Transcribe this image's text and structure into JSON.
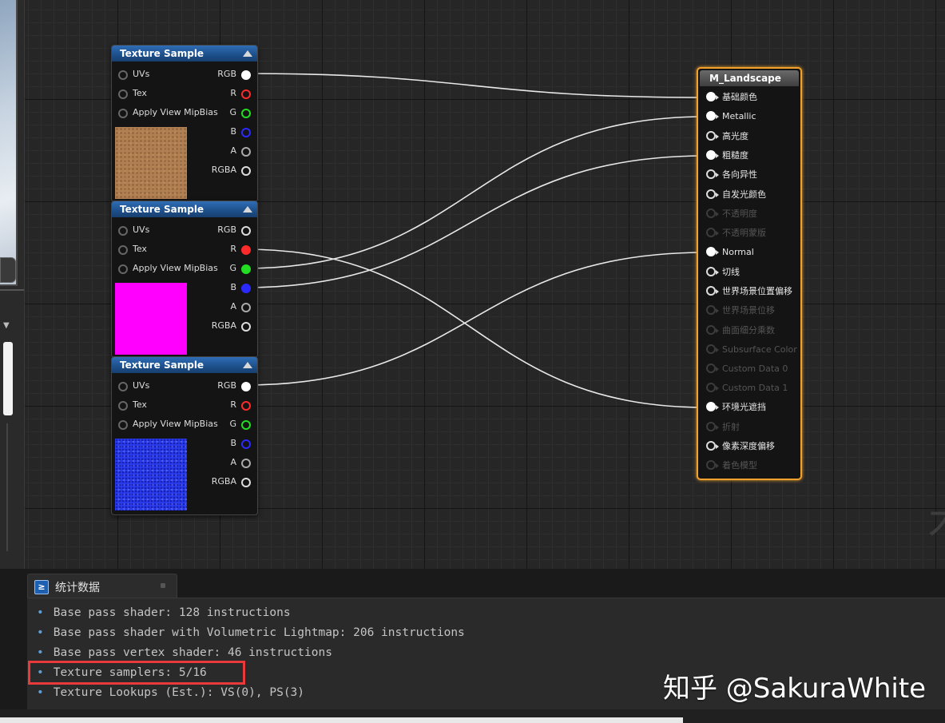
{
  "nodes": [
    {
      "title": "Texture Sample",
      "inputs": [
        "UVs",
        "Tex",
        "Apply View MipBias"
      ],
      "outputs": [
        "RGB",
        "R",
        "G",
        "B",
        "A",
        "RGBA"
      ],
      "thumb_color": "#b07f52"
    },
    {
      "title": "Texture Sample",
      "inputs": [
        "UVs",
        "Tex",
        "Apply View MipBias"
      ],
      "outputs": [
        "RGB",
        "R",
        "G",
        "B",
        "A",
        "RGBA"
      ],
      "thumb_color": "#ff00ff"
    },
    {
      "title": "Texture Sample",
      "inputs": [
        "UVs",
        "Tex",
        "Apply View MipBias"
      ],
      "outputs": [
        "RGB",
        "R",
        "G",
        "B",
        "A",
        "RGBA"
      ],
      "thumb_color": "#2a3bf0"
    }
  ],
  "material": {
    "title": "M_Landscape",
    "pins": [
      {
        "label": "基础颜色",
        "enabled": true,
        "connected": true
      },
      {
        "label": "Metallic",
        "enabled": true,
        "connected": true
      },
      {
        "label": "高光度",
        "enabled": true,
        "connected": false
      },
      {
        "label": "粗糙度",
        "enabled": true,
        "connected": true
      },
      {
        "label": "各向异性",
        "enabled": true,
        "connected": false
      },
      {
        "label": "自发光颜色",
        "enabled": true,
        "connected": false
      },
      {
        "label": "不透明度",
        "enabled": false,
        "connected": false
      },
      {
        "label": "不透明蒙版",
        "enabled": false,
        "connected": false
      },
      {
        "label": "Normal",
        "enabled": true,
        "connected": true
      },
      {
        "label": "切线",
        "enabled": true,
        "connected": false
      },
      {
        "label": "世界场景位置偏移",
        "enabled": true,
        "connected": false
      },
      {
        "label": "世界场景位移",
        "enabled": false,
        "connected": false
      },
      {
        "label": "曲面细分乘数",
        "enabled": false,
        "connected": false
      },
      {
        "label": "Subsurface Color",
        "enabled": false,
        "connected": false
      },
      {
        "label": "Custom Data 0",
        "enabled": false,
        "connected": false
      },
      {
        "label": "Custom Data 1",
        "enabled": false,
        "connected": false
      },
      {
        "label": "环境光遮挡",
        "enabled": true,
        "connected": true
      },
      {
        "label": "折射",
        "enabled": false,
        "connected": false
      },
      {
        "label": "像素深度偏移",
        "enabled": true,
        "connected": false
      },
      {
        "label": "着色模型",
        "enabled": false,
        "connected": false
      }
    ]
  },
  "stats": {
    "tab_label": "统计数据",
    "lines": [
      "Base pass shader: 128 instructions",
      "Base pass shader with Volumetric Lightmap: 206 instructions",
      "Base pass vertex shader: 46 instructions",
      "Texture samplers: 5/16",
      "Texture Lookups (Est.): VS(0), PS(3)"
    ]
  },
  "watermark": "知乎 @SakuraWhite",
  "colors": {
    "pin_r": "#ff2a2a",
    "pin_g": "#22dd22",
    "pin_b": "#2a2aff",
    "material_border": "#f2a12c",
    "highlight": "#e83a3a"
  }
}
